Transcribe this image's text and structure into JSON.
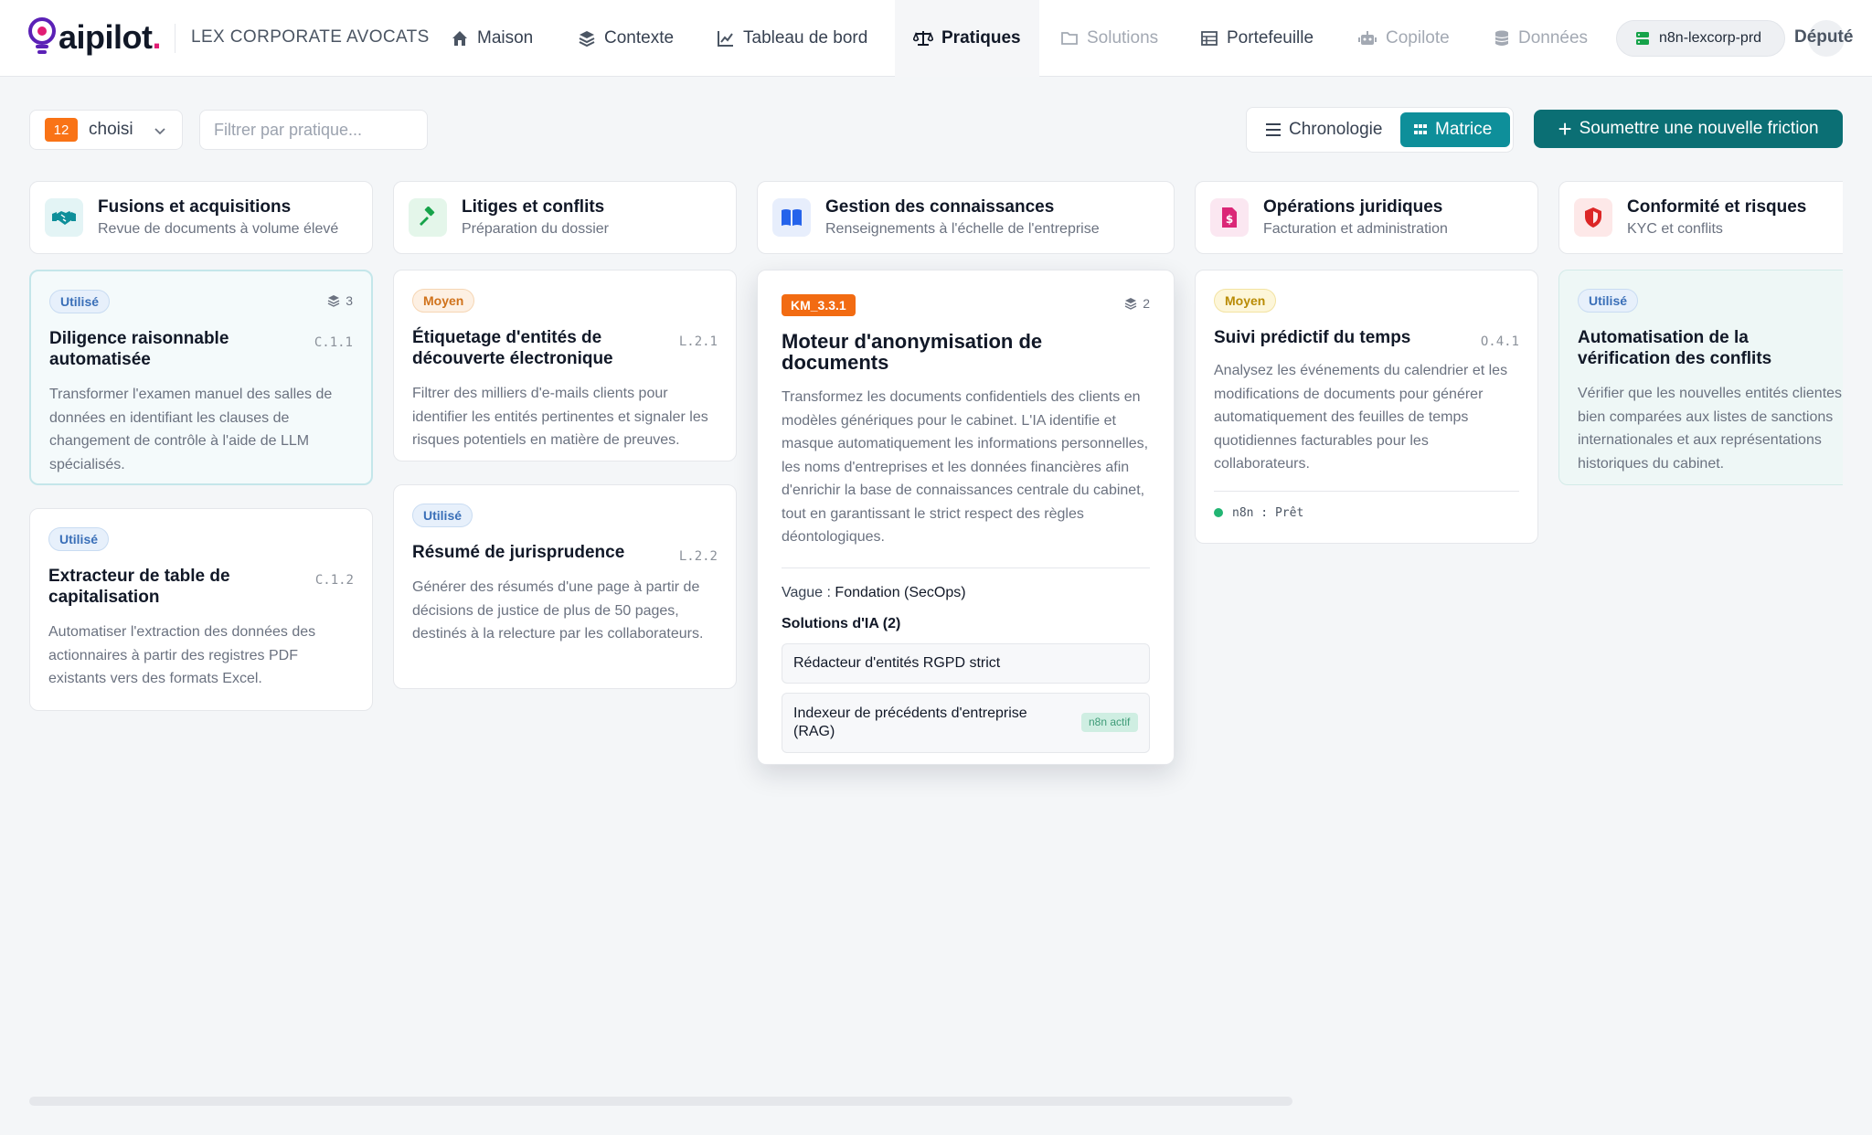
{
  "brand": {
    "logo_text": "aipilot",
    "logo_dot": ".",
    "firm_name": "LEX CORPORATE AVOCATS",
    "accent": "#e11d74"
  },
  "nav": [
    {
      "label": "Maison",
      "icon": "home-icon",
      "state": "normal"
    },
    {
      "label": "Contexte",
      "icon": "layers-icon",
      "state": "normal"
    },
    {
      "label": "Tableau de bord",
      "icon": "line-chart-icon",
      "state": "normal"
    },
    {
      "label": "Pratiques",
      "icon": "scale-icon",
      "state": "active"
    },
    {
      "label": "Solutions",
      "icon": "folder-icon",
      "state": "disabled"
    },
    {
      "label": "Portefeuille",
      "icon": "table-icon",
      "state": "normal"
    },
    {
      "label": "Copilote",
      "icon": "robot-icon",
      "state": "disabled"
    },
    {
      "label": "Données",
      "icon": "database-icon",
      "state": "disabled"
    }
  ],
  "environment": {
    "label": "n8n-lexcorp-prd",
    "icon": "server-icon"
  },
  "user": {
    "label": "Député"
  },
  "toolbar": {
    "selected_count": "12",
    "selected_label": "choisi",
    "filter_placeholder": "Filtrer par pratique...",
    "view_timeline": "Chronologie",
    "view_matrix": "Matrice",
    "active_view": "Matrice",
    "submit_label": "Soumettre une nouvelle friction",
    "submit_color": "#0b6f74"
  },
  "columns": [
    {
      "title": "Fusions et acquisitions",
      "subtitle": "Revue de documents à volume élevé",
      "icon": "handshake-icon",
      "icon_color": "#0e8f9a",
      "cards": [
        {
          "badge": "Utilisé",
          "layers": "3",
          "title": "Diligence raisonnable automatisée",
          "code": "C.1.1",
          "description": "Transformer l'examen manuel des salles de données en identifiant les clauses de changement de contrôle à l'aide de LLM spécialisés."
        },
        {
          "badge": "Utilisé",
          "title": "Extracteur de table de capitalisation",
          "code": "C.1.2",
          "description": "Automatiser l'extraction des données des actionnaires à partir des registres PDF existants vers des formats Excel."
        }
      ]
    },
    {
      "title": "Litiges et conflits",
      "subtitle": "Préparation du dossier",
      "icon": "gavel-icon",
      "icon_color": "#16a34a",
      "cards": [
        {
          "badge": "Moyen",
          "title": "Étiquetage d'entités de découverte électronique",
          "code": "L.2.1",
          "description": "Filtrer des milliers d'e-mails clients pour identifier les entités pertinentes et signaler les risques potentiels en matière de preuves."
        },
        {
          "badge": "Utilisé",
          "title": "Résumé de jurisprudence",
          "code": "L.2.2",
          "description": "Générer des résumés d'une page à partir de décisions de justice de plus de 50 pages, destinés à la relecture par les collaborateurs."
        }
      ]
    },
    {
      "title": "Gestion des connaissances",
      "subtitle": "Renseignements à l'échelle de l'entreprise",
      "icon": "book-icon",
      "icon_color": "#2563eb",
      "cards": [
        {
          "badge": "KM_3.3.1",
          "layers": "2",
          "title": "Moteur d'anonymisation de documents",
          "description": "Transformez les documents confidentiels des clients en modèles génériques pour le cabinet. L'IA identifie et masque automatiquement les informations personnelles, les noms d'entreprises et les données financières afin d'enrichir la base de connaissances centrale du cabinet, tout en garantissant le strict respect des règles déontologiques.",
          "wave_label": "Vague :",
          "wave_value": "Fondation (SecOps)",
          "solutions_title": "Solutions d'IA (2)",
          "solutions": [
            {
              "name": "Rédacteur d'entités RGPD strict"
            },
            {
              "name": "Indexeur de précédents d'entreprise (RAG)",
              "tag": "n8n actif"
            }
          ]
        }
      ]
    },
    {
      "title": "Opérations juridiques",
      "subtitle": "Facturation et administration",
      "icon": "invoice-icon",
      "icon_color": "#db2777",
      "cards": [
        {
          "badge": "Moyen",
          "title": "Suivi prédictif du temps",
          "code": "O.4.1",
          "description": "Analysez les événements du calendrier et les modifications de documents pour générer automatiquement des feuilles de temps quotidiennes facturables pour les collaborateurs.",
          "status": "n8n : Prêt"
        }
      ]
    },
    {
      "title": "Conformité et risques",
      "subtitle": "KYC et conflits",
      "icon": "shield-icon",
      "icon_color": "#dc2626",
      "cards": [
        {
          "badge": "Utilisé",
          "title": "Automatisation de la vérification des conflits",
          "description": "Vérifier que les nouvelles entités clientes sont bien comparées aux listes de sanctions internationales et aux représentations historiques du cabinet."
        }
      ]
    }
  ]
}
